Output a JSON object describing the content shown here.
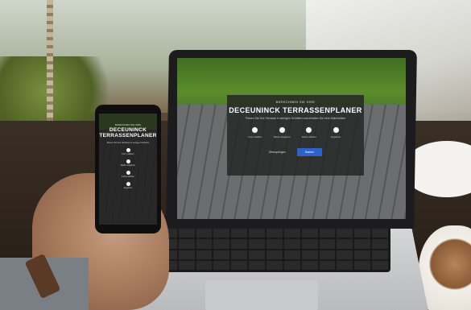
{
  "laptop_app": {
    "kicker": "BERECHNEN SIE IHRE",
    "title": "DECEUNINCK TERRASSENPLANER",
    "description": "Planen Sie Ihre Terrasse in wenigen Schritten und erhalten Sie eine Materialliste",
    "steps": [
      {
        "icon": "shape-icon",
        "label": "Form wählen"
      },
      {
        "icon": "size-icon",
        "label": "Maße eingeben"
      },
      {
        "icon": "color-icon",
        "label": "Farbe wählen"
      },
      {
        "icon": "list-icon",
        "label": "Ergebnis"
      }
    ],
    "skip_label": "Überspringen",
    "start_label": "Starten"
  },
  "phone_app": {
    "kicker": "BERECHNEN SIE IHRE",
    "title_line1": "DECEUNINCK",
    "title_line2": "TERRASSENPLANER",
    "description": "Planen Sie Ihre Terrasse in wenigen Schritten",
    "steps": [
      {
        "icon": "shape-icon",
        "label": "Form wählen"
      },
      {
        "icon": "size-icon",
        "label": "Maße eingeben"
      },
      {
        "icon": "color-icon",
        "label": "Farbe wählen"
      },
      {
        "icon": "list-icon",
        "label": "Ergebnis"
      }
    ]
  },
  "colors": {
    "accent_button": "#2b63c9",
    "dialog_bg": "#232323",
    "lawn": "#5b8c2c",
    "deck": "#6c6d6e"
  }
}
